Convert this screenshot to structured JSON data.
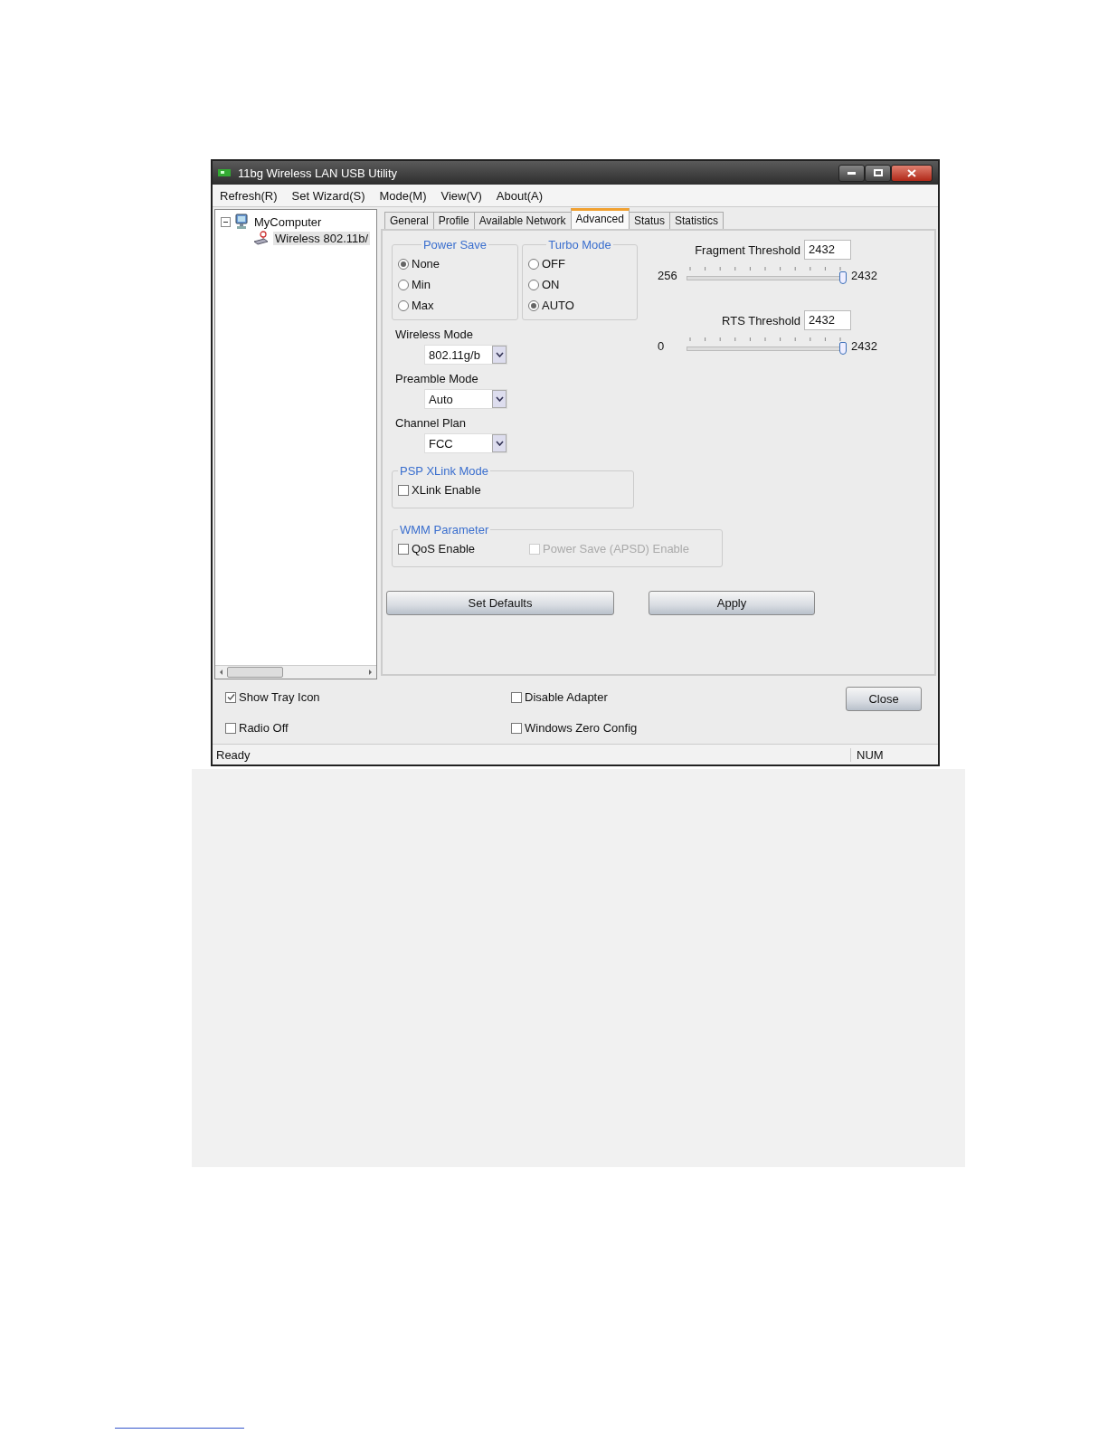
{
  "window": {
    "title": "11bg Wireless LAN USB Utility"
  },
  "menu": [
    "Refresh(R)",
    "Set Wizard(S)",
    "Mode(M)",
    "View(V)",
    "About(A)"
  ],
  "tree": [
    {
      "label": "MyComputer",
      "expanded": true,
      "selected": false,
      "children": [
        {
          "label": "Wireless 802.11b/",
          "selected": true
        }
      ]
    }
  ],
  "tabs": [
    {
      "label": "General",
      "selected": false
    },
    {
      "label": "Profile",
      "selected": false
    },
    {
      "label": "Available Network",
      "selected": false
    },
    {
      "label": "Advanced",
      "selected": true
    },
    {
      "label": "Status",
      "selected": false
    },
    {
      "label": "Statistics",
      "selected": false
    }
  ],
  "power_save": {
    "title": "Power Save",
    "options": [
      {
        "label": "None",
        "selected": true
      },
      {
        "label": "Min",
        "selected": false
      },
      {
        "label": "Max",
        "selected": false
      }
    ]
  },
  "turbo_mode": {
    "title": "Turbo Mode",
    "options": [
      {
        "label": "OFF",
        "selected": false
      },
      {
        "label": "ON",
        "selected": false
      },
      {
        "label": "AUTO",
        "selected": true
      }
    ]
  },
  "dropdowns": [
    {
      "label": "Wireless Mode",
      "value": "802.11g/b"
    },
    {
      "label": "Preamble Mode",
      "value": "Auto"
    },
    {
      "label": "Channel Plan",
      "value": "FCC"
    }
  ],
  "thresholds": [
    {
      "label": "Fragment Threshold",
      "value": "2432",
      "min": "256",
      "max": "2432",
      "level": 1
    },
    {
      "label": "RTS Threshold",
      "value": "2432",
      "min": "0",
      "max": "2432",
      "level": 1
    }
  ],
  "psp_xlink": {
    "title": "PSP XLink Mode",
    "checkboxes": [
      {
        "label": "XLink Enable",
        "checked": false,
        "disabled": false
      }
    ]
  },
  "wmm": {
    "title": "WMM Parameter",
    "checkboxes": [
      {
        "label": "QoS Enable",
        "checked": false,
        "disabled": false
      },
      {
        "label": "Power Save (APSD) Enable",
        "checked": false,
        "disabled": true
      }
    ]
  },
  "buttons": [
    "Set Defaults",
    "Apply"
  ],
  "options": [
    {
      "label": "Show Tray Icon",
      "checked": true
    },
    {
      "label": "Disable Adapter",
      "checked": false
    },
    {
      "label": "Radio Off",
      "checked": false
    },
    {
      "label": "Windows Zero Config",
      "checked": false
    }
  ],
  "close_button": "Close",
  "status_bar": [
    "Ready",
    "NUM"
  ]
}
